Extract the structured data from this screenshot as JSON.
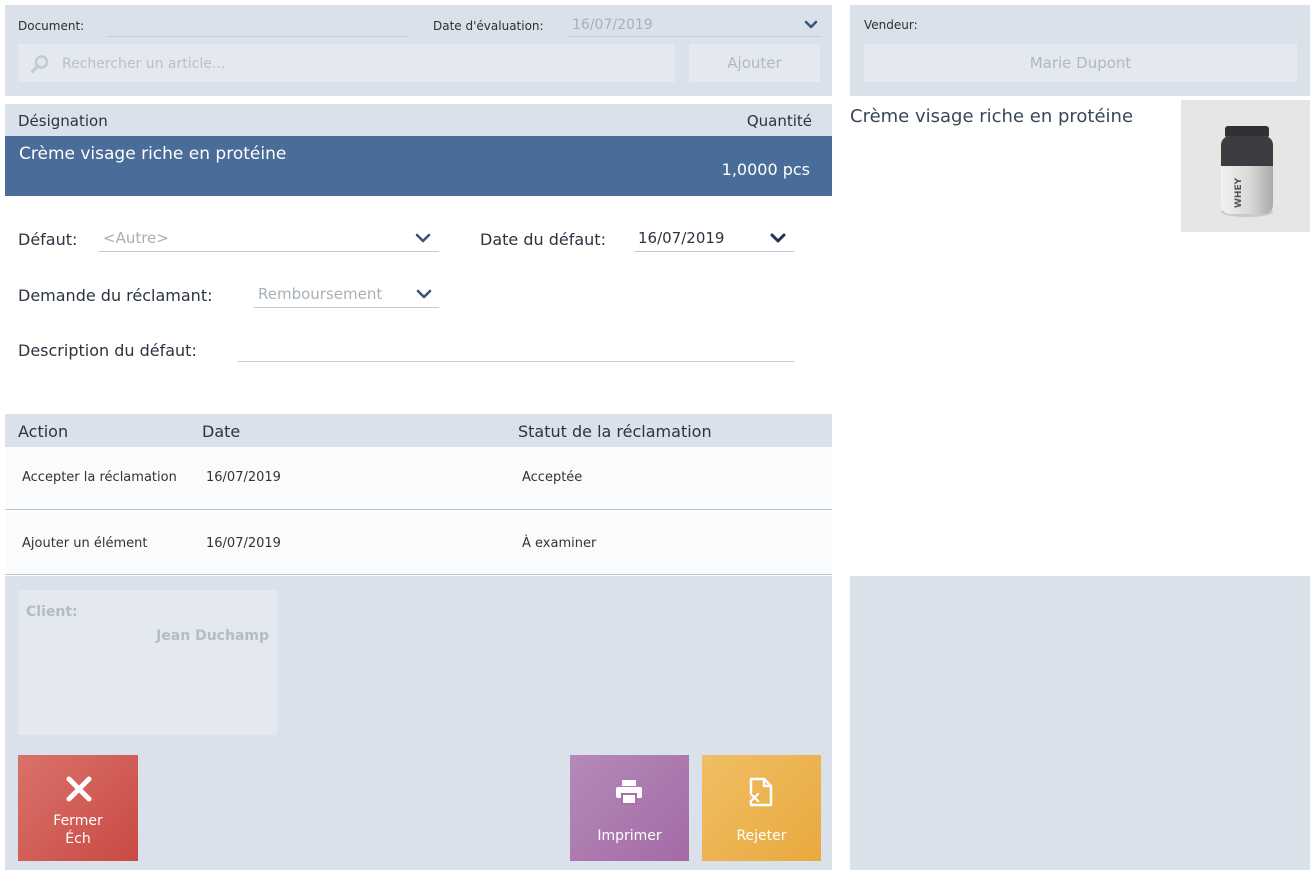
{
  "header": {
    "document_label": "Document:",
    "document_value": "",
    "eval_date_label": "Date d'évaluation:",
    "eval_date_value": "16/07/2019",
    "search_placeholder": "Rechercher un article...",
    "add_label": "Ajouter"
  },
  "seller": {
    "label": "Vendeur:",
    "name": "Marie Dupont"
  },
  "items": {
    "col_designation": "Désignation",
    "col_quantity": "Quantité",
    "selected": {
      "name": "Crème visage riche en protéine",
      "quantity": "1,0000 pcs"
    }
  },
  "product_preview": {
    "title": "Crème visage riche en protéine",
    "image_icon": "whey-protein-jar-image",
    "jar_text": "WHEY"
  },
  "form": {
    "defect_label": "Défaut:",
    "defect_value": "<Autre>",
    "defect_date_label": "Date du défaut:",
    "defect_date_value": "16/07/2019",
    "request_label": "Demande du réclamant:",
    "request_value": "Remboursement",
    "description_label": "Description du défaut:",
    "description_value": ""
  },
  "actions": {
    "columns": [
      "Action",
      "Date",
      "Statut de la réclamation"
    ],
    "rows": [
      {
        "action": "Accepter la réclamation",
        "date": "16/07/2019",
        "status": "Acceptée"
      },
      {
        "action": "Ajouter un élément",
        "date": "16/07/2019",
        "status": "À examiner"
      }
    ]
  },
  "client": {
    "label": "Client:",
    "name": "Jean Duchamp"
  },
  "buttons": {
    "close_line1": "Fermer",
    "close_line2": "Éch",
    "close_icon": "close-x-icon",
    "print": "Imprimer",
    "print_icon": "printer-icon",
    "reject": "Rejeter",
    "reject_icon": "reject-document-icon"
  },
  "colors": {
    "panel_bg": "#dae1ea",
    "selected_row": "#4a6c98",
    "close_tile": "#cf5a52",
    "print_tile": "#a874aa",
    "reject_tile": "#ecb04a"
  }
}
